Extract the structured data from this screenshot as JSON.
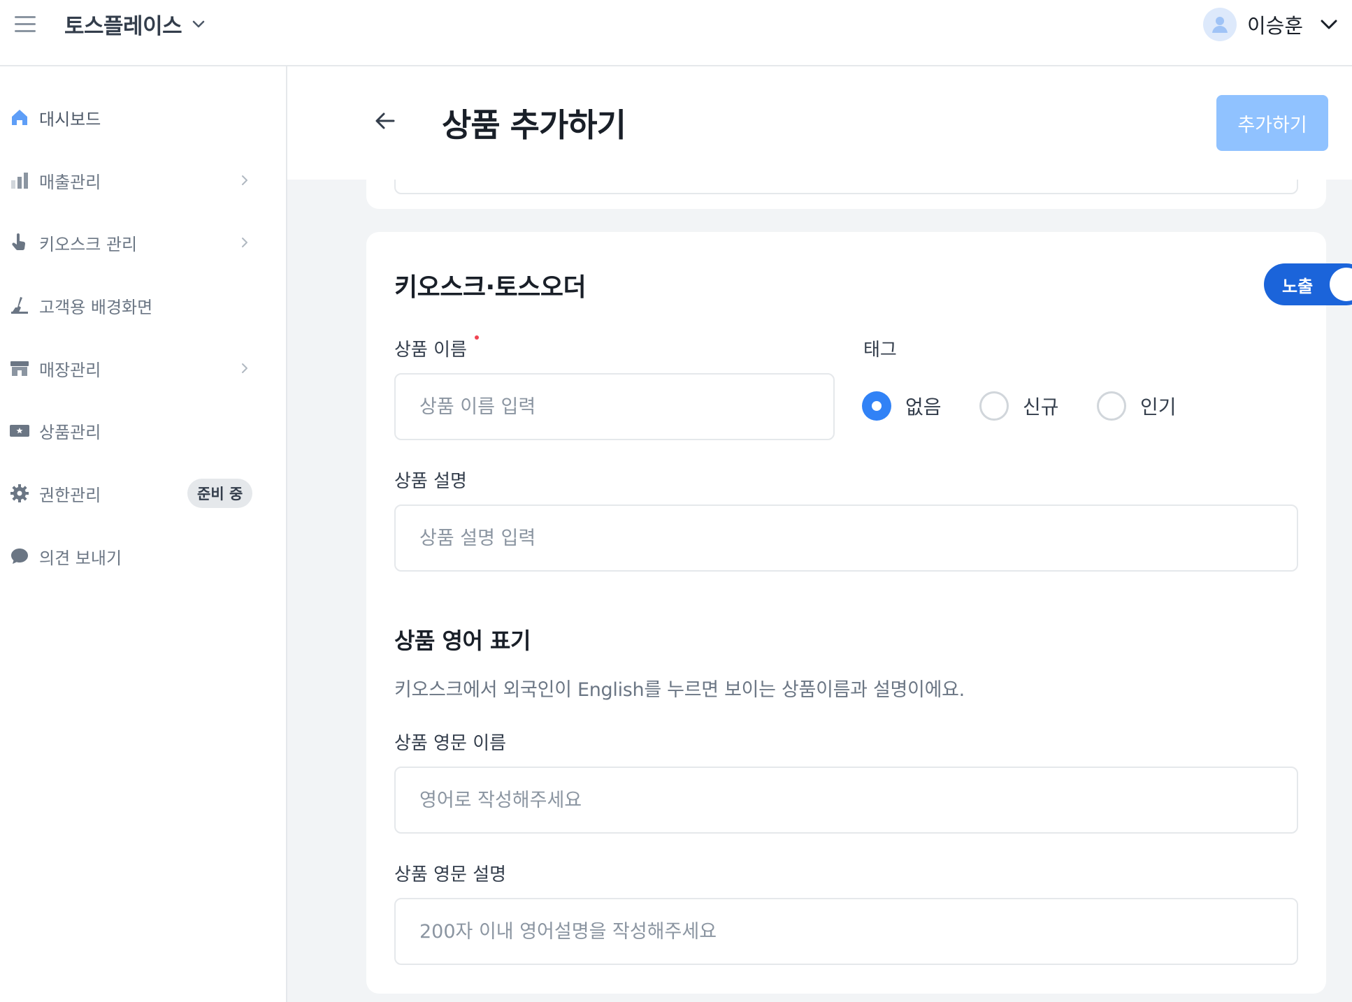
{
  "topbar": {
    "brand": "토스플레이스",
    "user_name": "이승훈"
  },
  "sidebar": {
    "items": [
      {
        "label": "대시보드",
        "icon": "home-icon",
        "has_chevron": false,
        "active": true
      },
      {
        "label": "매출관리",
        "icon": "bar-chart-icon",
        "has_chevron": true
      },
      {
        "label": "키오스크 관리",
        "icon": "pointer-hand-icon",
        "has_chevron": true
      },
      {
        "label": "고객용 배경화면",
        "icon": "brush-icon",
        "has_chevron": false
      },
      {
        "label": "매장관리",
        "icon": "store-icon",
        "has_chevron": true
      },
      {
        "label": "상품관리",
        "icon": "ticket-icon",
        "has_chevron": false
      },
      {
        "label": "권한관리",
        "icon": "gear-icon",
        "has_chevron": false,
        "badge": "준비 중"
      },
      {
        "label": "의견 보내기",
        "icon": "chat-bubble-icon",
        "has_chevron": false
      }
    ]
  },
  "header": {
    "title": "상품 추가하기",
    "add_button": "추가하기"
  },
  "kiosk_section": {
    "title": "키오스크·토스오더",
    "toggle_label": "노출",
    "toggle_on": true,
    "name_label": "상품 이름",
    "name_placeholder": "상품 이름 입력",
    "tag_label": "태그",
    "tags": [
      {
        "label": "없음",
        "checked": true
      },
      {
        "label": "신규",
        "checked": false
      },
      {
        "label": "인기",
        "checked": false
      }
    ],
    "desc_label": "상품 설명",
    "desc_placeholder": "상품 설명 입력"
  },
  "english_section": {
    "title": "상품 영어 표기",
    "description": "키오스크에서 외국인이 English를 누르면 보이는 상품이름과 설명이에요.",
    "name_label": "상품 영문 이름",
    "name_placeholder": "영어로 작성해주세요",
    "desc_label": "상품 영문 설명",
    "desc_placeholder": "200자 이내 영어설명을 작성해주세요"
  },
  "colors": {
    "primary": "#3182f6",
    "toggle": "#1b64da",
    "button_disabled": "#90c2ff",
    "required": "#f04452"
  }
}
